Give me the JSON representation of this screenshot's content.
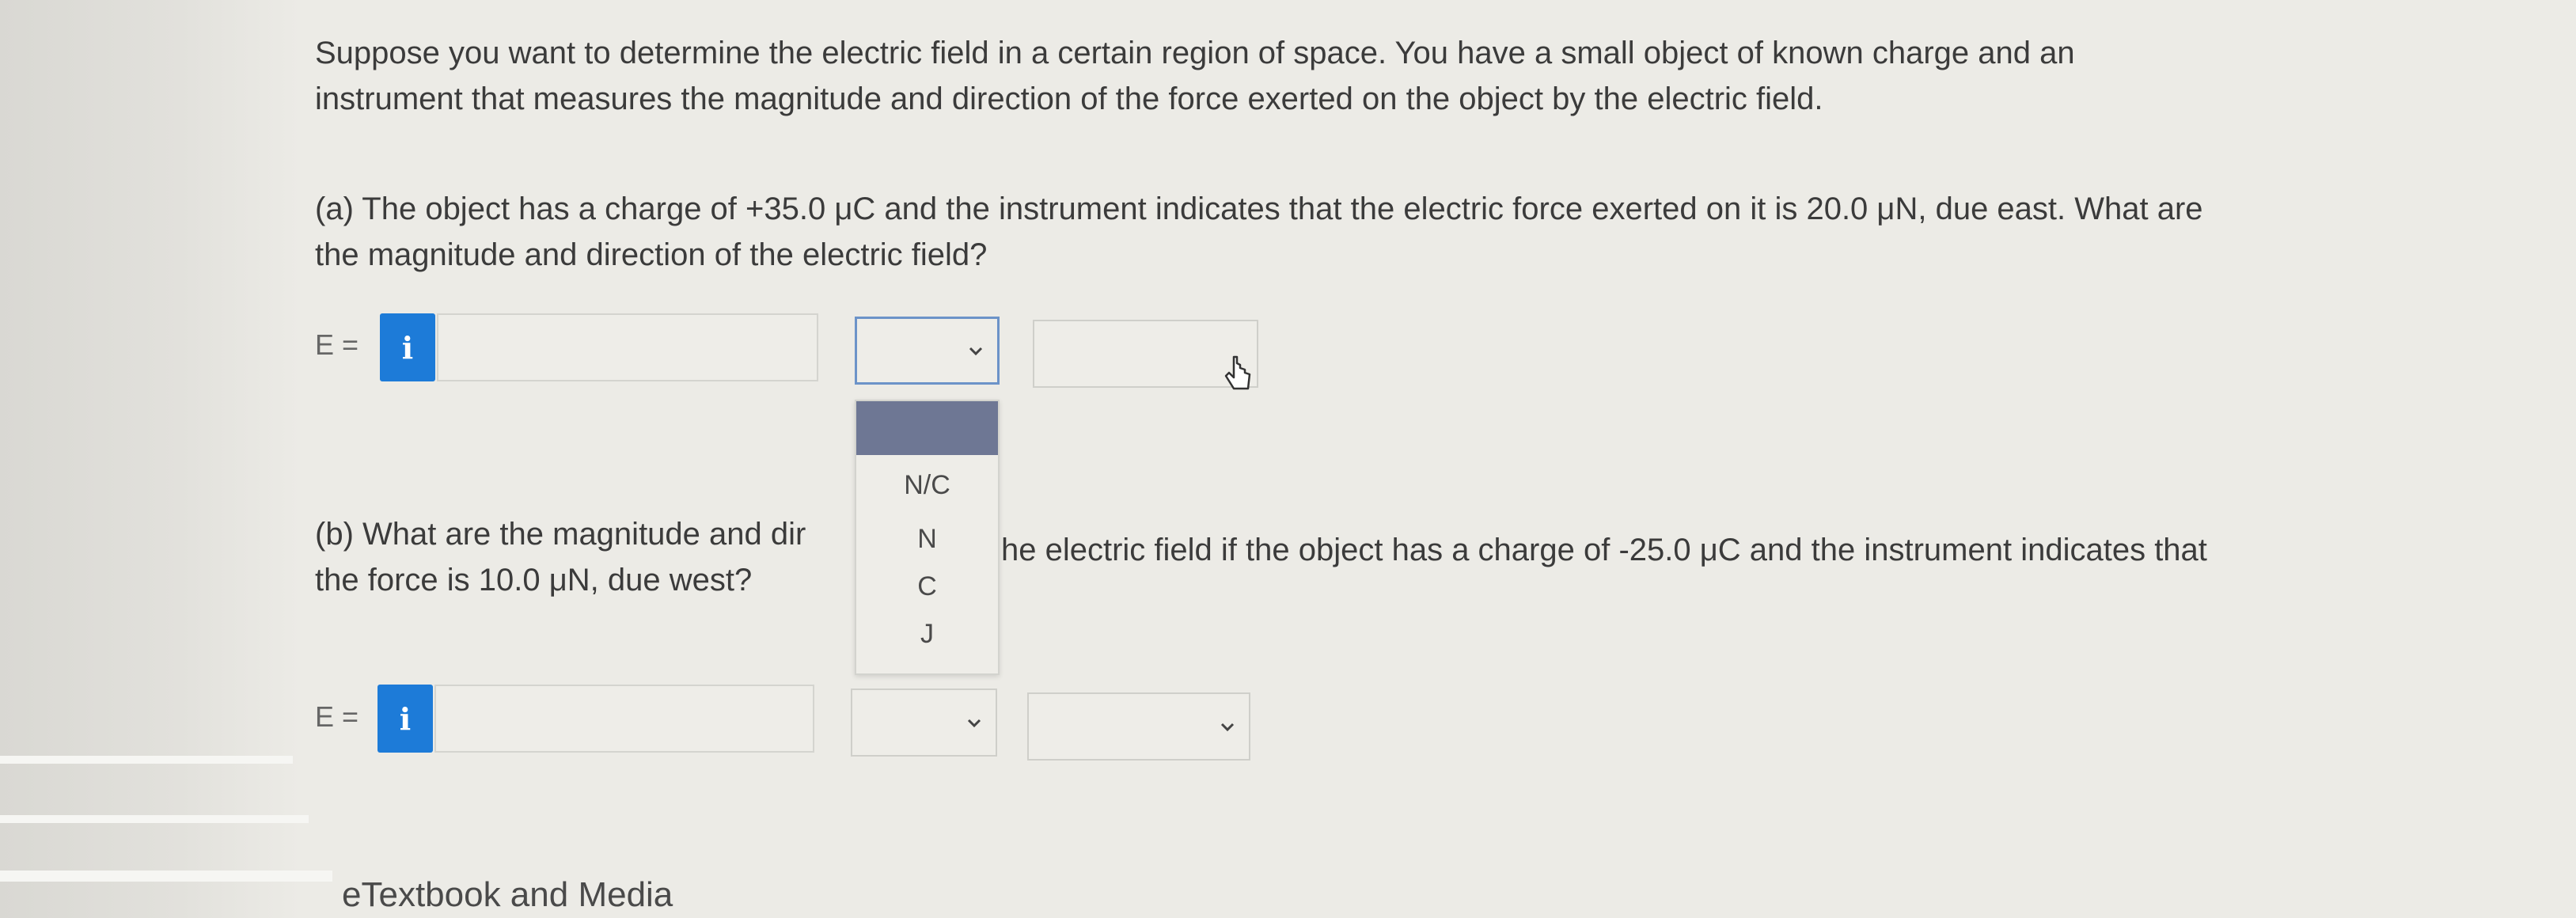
{
  "question": {
    "intro_lines": [
      "Suppose you want to determine the electric field in a certain region of space. You have a small object of known charge and an",
      "instrument that measures the magnitude and direction of the force exerted on the object by the electric field."
    ],
    "part_a_lines": [
      "(a) The object has a charge of +35.0 μC and the instrument indicates that the electric force exerted on it is 20.0 μN, due east. What are",
      "the magnitude and direction of the electric field?"
    ],
    "part_b_line1_left": "(b) What are the magnitude and dir",
    "part_b_line1_right": "he electric field if the object has a charge of -25.0 μC and the instrument indicates that",
    "part_b_line2": "the force is 10.0 μN, due west?"
  },
  "answer_a": {
    "label": "E =",
    "info_icon": "i",
    "value": "",
    "unit_selected": "",
    "direction_selected": ""
  },
  "answer_b": {
    "label": "E =",
    "info_icon": "i",
    "value": "",
    "unit_selected": "",
    "direction_selected": ""
  },
  "unit_dropdown": {
    "options": [
      "",
      "N/C",
      "N",
      "C",
      "J"
    ]
  },
  "footer": {
    "link_text": "eTextbook and Media"
  },
  "icons": {
    "info": "info-icon",
    "chevron": "chevron-down-icon",
    "cursor": "hand-pointer-icon"
  },
  "colors": {
    "info_button": "#1d7bd8",
    "dropdown_highlight": "#6e7794",
    "open_select_border": "#6c93c8"
  }
}
